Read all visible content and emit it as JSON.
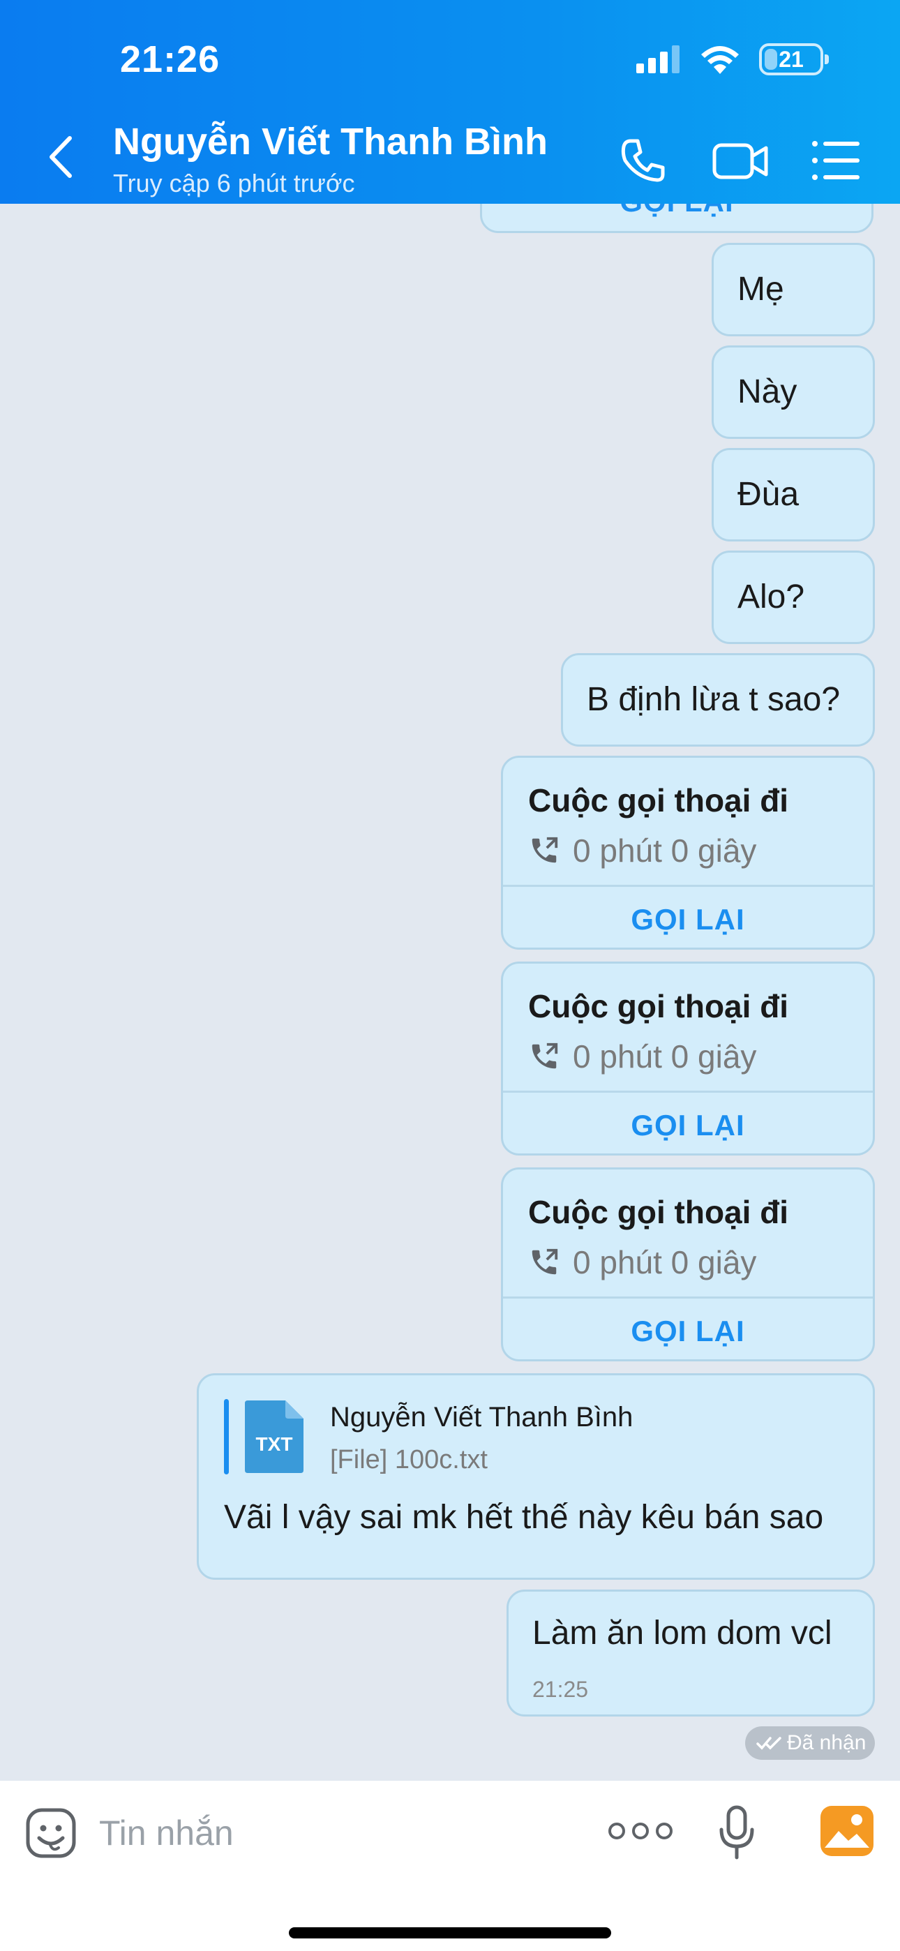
{
  "status_bar": {
    "time": "21:26",
    "battery": "21"
  },
  "header": {
    "title": "Nguyễn Viết Thanh Bình",
    "subtitle": "Truy cập 6 phút trước"
  },
  "messages": {
    "partial_recall": "GỌI LẠI",
    "texts": [
      "Mẹ",
      "Này",
      "Đùa",
      "Alo?",
      "B định lừa t sao?"
    ],
    "calls": [
      {
        "title": "Cuộc gọi thoại đi",
        "duration": "0 phút 0 giây",
        "action": "GỌI LẠI"
      },
      {
        "title": "Cuộc gọi thoại đi",
        "duration": "0 phút 0 giây",
        "action": "GỌI LẠI"
      },
      {
        "title": "Cuộc gọi thoại đi",
        "duration": "0 phút 0 giây",
        "action": "GỌI LẠI"
      }
    ],
    "reply": {
      "quoted_name": "Nguyễn Viết Thanh Bình",
      "quoted_file": "[File] 100c.txt",
      "file_type": "TXT",
      "text": "Vãi l vậy sai mk hết thế này kêu bán sao"
    },
    "last": {
      "text": "Làm ăn lom dom vcl",
      "time": "21:25"
    },
    "status": "Đã nhận"
  },
  "input": {
    "placeholder": "Tin nhắn"
  },
  "colors": {
    "header_start": "#0a7cf0",
    "header_end": "#0ba6f3",
    "bubble": "#d3edfb",
    "accent": "#1a8ef0",
    "background": "#e2e8f0"
  }
}
